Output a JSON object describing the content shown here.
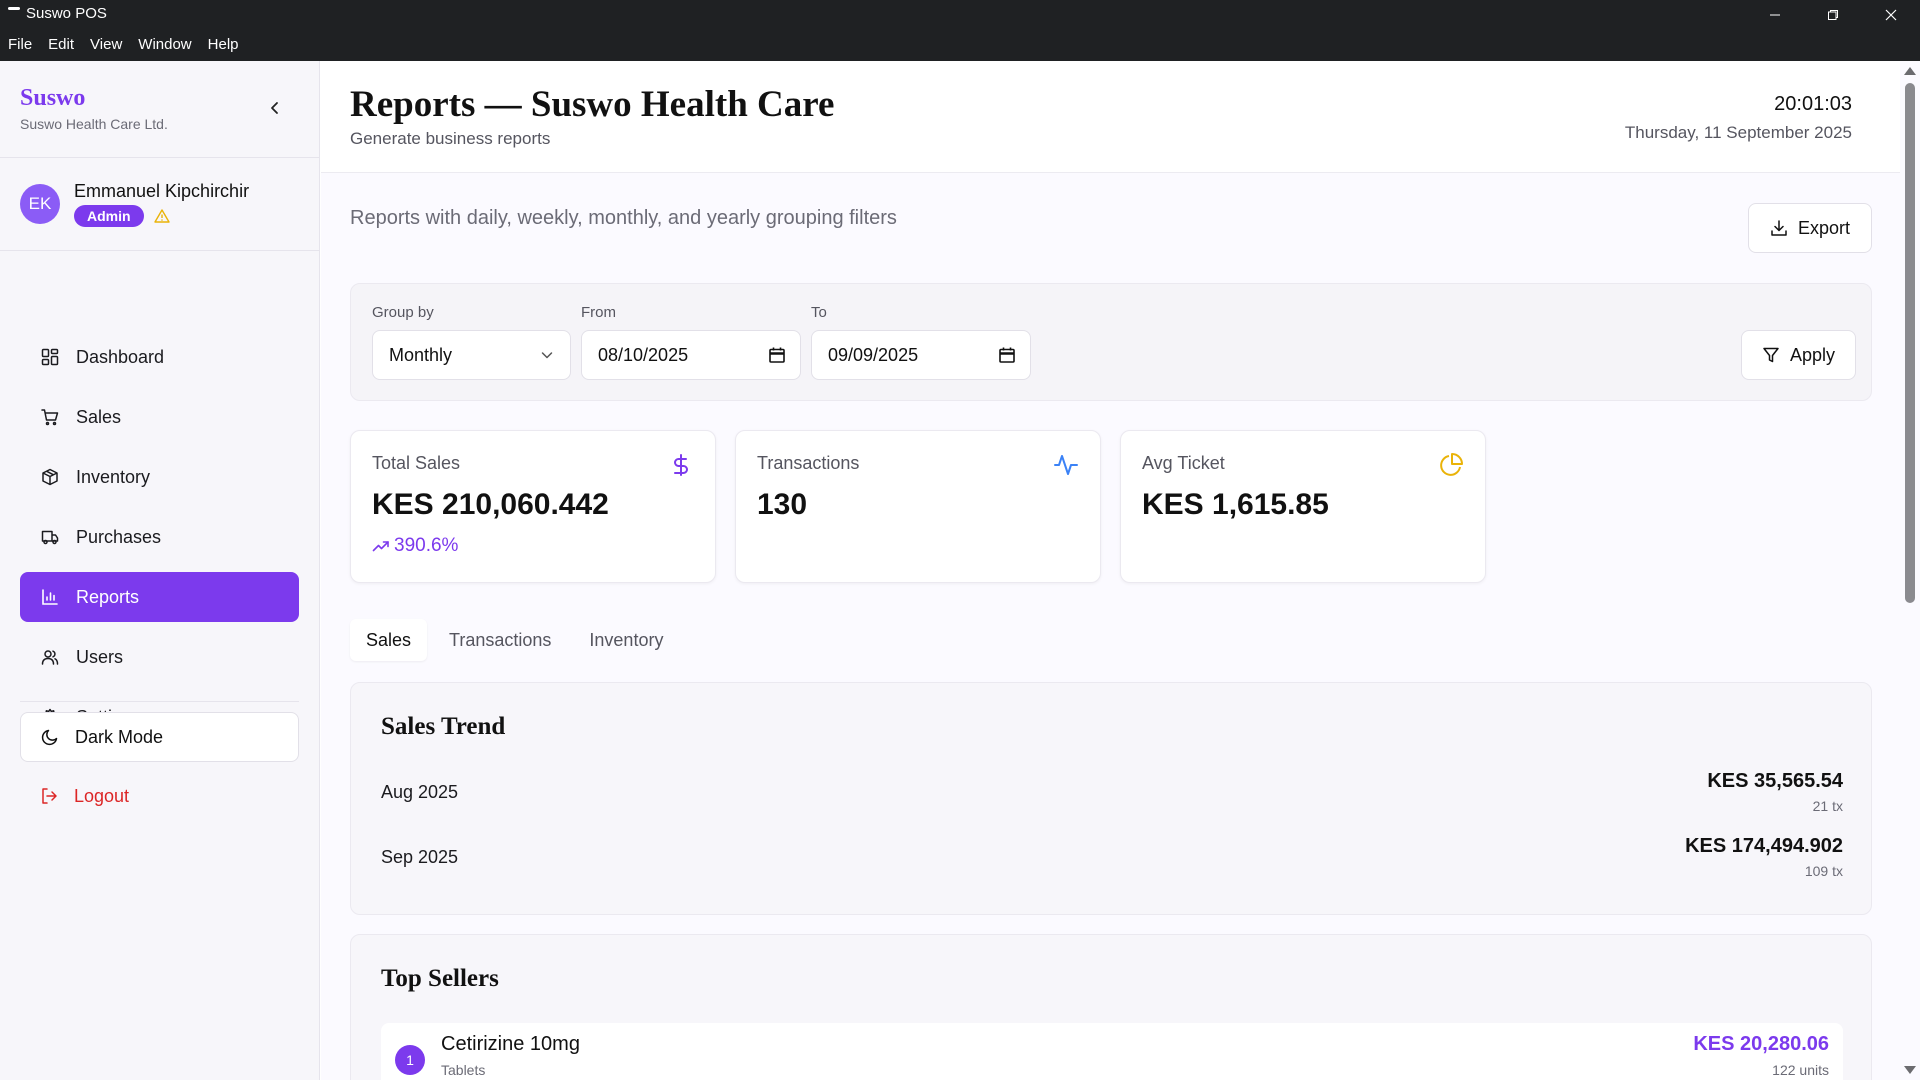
{
  "window": {
    "title": "Suswo POS",
    "menu": [
      "File",
      "Edit",
      "View",
      "Window",
      "Help"
    ]
  },
  "sidebar": {
    "brand": "Suswo",
    "brand_sub": "Suswo Health Care Ltd.",
    "user": {
      "initials": "EK",
      "name": "Emmanuel Kipchirchir",
      "role": "Admin"
    },
    "items": [
      {
        "label": "Dashboard",
        "icon": "dashboard-icon"
      },
      {
        "label": "Sales",
        "icon": "cart-icon"
      },
      {
        "label": "Inventory",
        "icon": "package-icon"
      },
      {
        "label": "Purchases",
        "icon": "truck-icon"
      },
      {
        "label": "Reports",
        "icon": "bar-chart-icon",
        "active": true
      },
      {
        "label": "Users",
        "icon": "users-icon"
      },
      {
        "label": "Settings",
        "icon": "gear-icon"
      }
    ],
    "dark_mode_label": "Dark Mode",
    "logout_label": "Logout"
  },
  "header": {
    "title": "Reports — Suswo Health Care",
    "subtitle": "Generate business reports",
    "time": "20:01:03",
    "date": "Thursday, 11 September 2025"
  },
  "main": {
    "description": "Reports with daily, weekly, monthly, and yearly grouping filters",
    "export_label": "Export",
    "filters": {
      "group_by_label": "Group by",
      "group_by_value": "Monthly",
      "from_label": "From",
      "from_value": "08/10/2025",
      "to_label": "To",
      "to_value": "09/09/2025",
      "apply_label": "Apply"
    },
    "stats": [
      {
        "label": "Total Sales",
        "value": "KES 210,060.442",
        "change": "390.6%",
        "icon": "dollar-icon"
      },
      {
        "label": "Transactions",
        "value": "130",
        "icon": "activity-icon"
      },
      {
        "label": "Avg Ticket",
        "value": "KES 1,615.85",
        "icon": "pie-chart-icon"
      }
    ],
    "tabs": [
      "Sales",
      "Transactions",
      "Inventory"
    ],
    "sales_trend": {
      "title": "Sales Trend",
      "rows": [
        {
          "period": "Aug 2025",
          "amount": "KES 35,565.54",
          "tx": "21 tx"
        },
        {
          "period": "Sep 2025",
          "amount": "KES 174,494.902",
          "tx": "109 tx"
        }
      ]
    },
    "top_sellers": {
      "title": "Top Sellers",
      "rows": [
        {
          "rank": "1",
          "name": "Cetirizine 10mg",
          "category": "Tablets",
          "amount": "KES 20,280.06",
          "units": "122 units"
        }
      ]
    }
  },
  "colors": {
    "accent": "#7c3aed",
    "danger": "#dc2626",
    "warning": "#eab308",
    "info": "#3b82f6"
  }
}
